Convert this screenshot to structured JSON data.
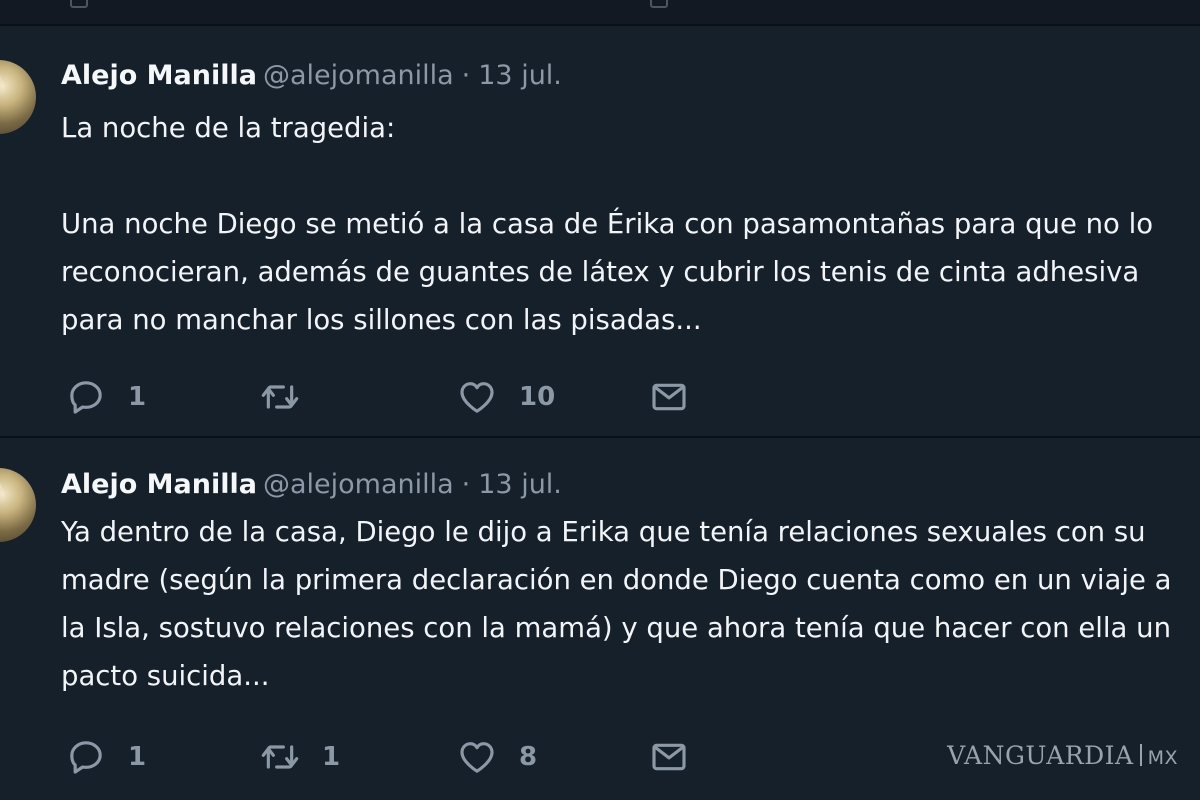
{
  "tweets": [
    {
      "author_name": "Alejo Manilla",
      "handle": "@alejomanilla",
      "separator": "·",
      "date": "13 jul.",
      "text": "La noche de la tragedia:\n\nUna noche Diego se metió a la casa de Érika con pasamontañas para que no lo\nreconocieran, además de guantes de látex y cubrir los tenis de cinta adhesiva\npara no manchar los sillones con las pisadas...",
      "replies": "1",
      "retweets": "",
      "likes": "10"
    },
    {
      "author_name": "Alejo Manilla",
      "handle": "@alejomanilla",
      "separator": "·",
      "date": "13 jul.",
      "text": "Ya dentro de la casa, Diego le dijo a Erika que tenía relaciones sexuales con su\nmadre (según la primera declaración en donde Diego cuenta como en un viaje a\nla Isla, sostuvo relaciones con la mamá) y que ahora tenía que hacer con ella un\npacto suicida...",
      "replies": "1",
      "retweets": "1",
      "likes": "8"
    }
  ],
  "icons": {
    "reply": "reply-icon",
    "retweet": "retweet-icon",
    "like": "heart-icon",
    "dm": "envelope-icon"
  },
  "watermark": {
    "brand": "VANGUARDIA",
    "region": "MX"
  },
  "colors": {
    "background": "#15202b",
    "text": "#f2f4f6",
    "secondary_text": "#8b98a5",
    "icon": "#8b98a5"
  }
}
